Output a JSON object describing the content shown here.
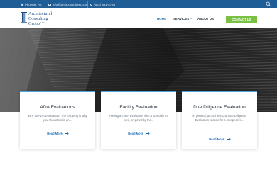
{
  "topbar": {
    "location": "Phoenix, AZ",
    "email": "info@archconsulting.com",
    "phone": "(602) 531-5736"
  },
  "logo": {
    "line1": "Architectural",
    "line2": "Consulting",
    "line3": "Group",
    "suffix": "LLC"
  },
  "nav": {
    "home": "HOME",
    "services": "SERVICES",
    "about": "ABOUT US",
    "cta": "CONTACT US"
  },
  "colors": {
    "topbar": "#1e5d96",
    "accent": "#1e6fb5",
    "cta": "#7ac143",
    "card_bar": "#4da3dc"
  },
  "cards": [
    {
      "title": "ADA Evaluations",
      "description": "Why an ADA Evaluation? The following is why you should retain an...",
      "link": "Read More"
    },
    {
      "title": "Facility Evaluation",
      "description": "Having an ADA Evaluation with a schedule to cure, prepared by the...",
      "link": "Read More"
    },
    {
      "title": "Due Diligence Evaluation",
      "description": "In general, an Architectural Due Diligence Evaluation is done for a prospective...",
      "link": "Read More"
    }
  ]
}
